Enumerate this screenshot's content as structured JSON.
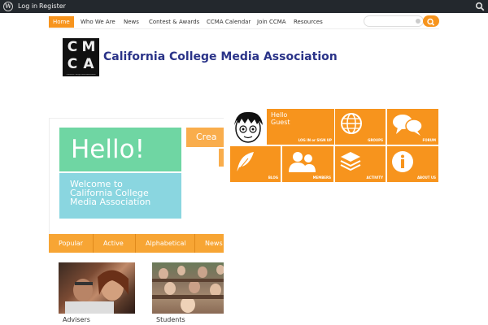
{
  "admin_bar": {
    "wp_glyph": "W",
    "login": "Log in",
    "register": "Register"
  },
  "nav": {
    "items": [
      "Home",
      "Who We Are",
      "News",
      "Contest & Awards",
      "CCMA Calendar",
      "Join CCMA",
      "Resources"
    ],
    "search_placeholder": ""
  },
  "logo": {
    "letters": [
      "C",
      "M",
      "C",
      "A"
    ],
    "tagline": "California College Media Association"
  },
  "site_title": "California College Media Association",
  "slider": {
    "hello": "Hello!",
    "welcome_lines": [
      "Welcome to",
      "California College",
      "Media Association"
    ],
    "next_slide_text": "Crea"
  },
  "tabs": [
    "Popular",
    "Active",
    "Alphabetical",
    "News"
  ],
  "cards": [
    {
      "caption": "Advisers"
    },
    {
      "caption": "Students"
    }
  ],
  "tiles": {
    "greeting_lines": [
      "Hello",
      "Guest"
    ],
    "login_label": "LOG IN or SIGN UP",
    "groups": "GROUPS",
    "forum": "FORUM",
    "blog": "BLOG",
    "members": "MEMBERS",
    "activity": "ACTIVITY",
    "about_us": "ABOUT US"
  },
  "colors": {
    "accent": "#f7941d",
    "title_blue": "#2a3388",
    "hello_green": "#6fd6a3",
    "welcome_blue": "#8ad6e0",
    "admin_bar": "#23282d"
  },
  "icons": [
    "wordpress-icon",
    "search-icon",
    "avatar-icon",
    "globe-icon",
    "chat-bubbles-icon",
    "feather-icon",
    "users-icon",
    "layers-icon",
    "info-icon"
  ]
}
